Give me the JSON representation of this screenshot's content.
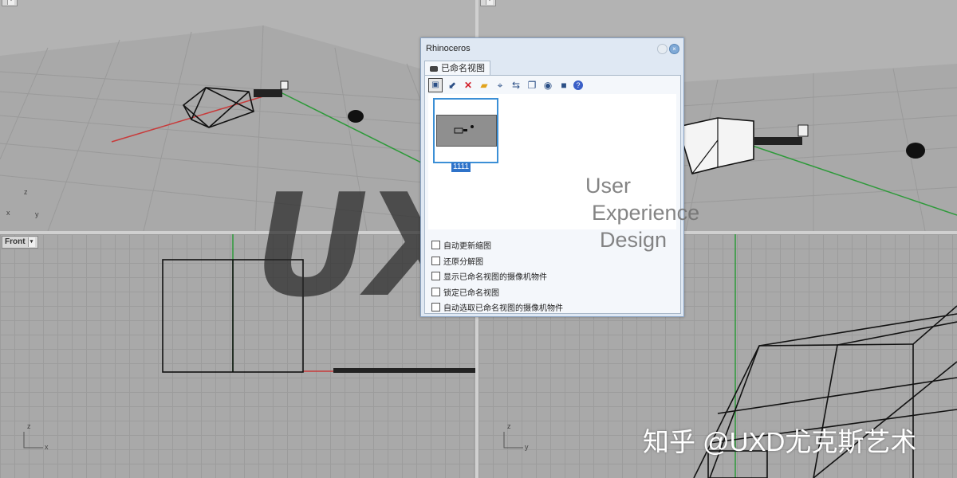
{
  "viewports": {
    "top_left_tab": "",
    "top_right_tab": "",
    "bottom_left_tab": "Front",
    "bottom_right_tab": ""
  },
  "axis_labels": {
    "persp": {
      "z": "z",
      "x": "x",
      "y": "y"
    },
    "front": {
      "z": "z",
      "x": "x"
    },
    "right": {
      "z": "z",
      "y": "y"
    }
  },
  "dialog": {
    "title": "Rhinoceros",
    "tab_label": "已命名视图",
    "toolbar": [
      {
        "name": "save-icon",
        "glyph": "▣"
      },
      {
        "name": "import-icon",
        "glyph": "⬋"
      },
      {
        "name": "delete-icon",
        "glyph": "✕"
      },
      {
        "name": "open-folder-icon",
        "glyph": "▰"
      },
      {
        "name": "select-icon",
        "glyph": "⌖"
      },
      {
        "name": "restore-icon",
        "glyph": "⇆"
      },
      {
        "name": "copy-icon",
        "glyph": "❐"
      },
      {
        "name": "view-icon",
        "glyph": "◉"
      },
      {
        "name": "window-icon",
        "glyph": "■"
      },
      {
        "name": "help-icon",
        "glyph": "?"
      }
    ],
    "thumbnail_label": "1111",
    "options": [
      "自动更新缩图",
      "还原分解图",
      "显示已命名视图的摄像机物件",
      "锁定已命名视图",
      "自动选取已命名视图的摄像机物件"
    ]
  },
  "watermark": {
    "logo": "UXD",
    "line1": "User",
    "line2": "Experience",
    "line3": "Design"
  },
  "credit": "知乎 @UXD尤克斯艺术"
}
